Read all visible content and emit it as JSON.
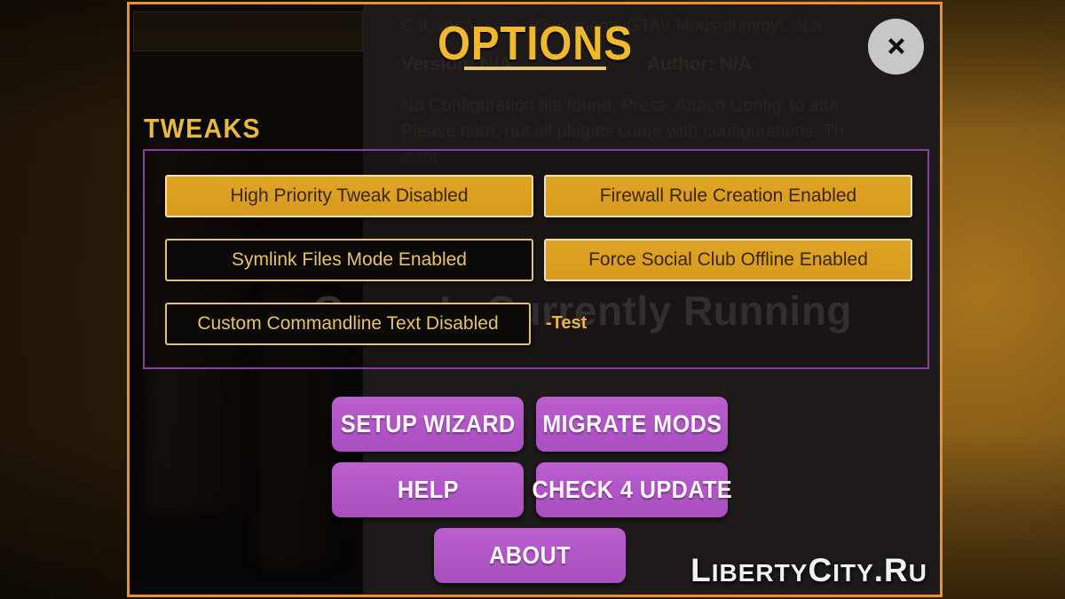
{
  "window": {
    "frame_color": "#ef8f2a",
    "background_color": "#110d0b"
  },
  "background": {
    "path": "C:\\Users\\______\\Documents\\GTAV Mods\\dummy\\...\\La",
    "version_label": "Version: N/A",
    "author_label": "Author: N/A",
    "description_line1": "No Configuration file found. Press 'Attach Config' to atta",
    "description_line2": "Please note, not all plugins come with configurations. Th",
    "description_line3": "error.",
    "status_text": "Game Is Currently Running"
  },
  "dialog": {
    "title": "OPTIONS",
    "title_color": "#f0b82b",
    "close_icon": "close-x-icon",
    "close_icon_bg": "#c7c7c7"
  },
  "tweaks": {
    "section_label": "TWEAKS",
    "panel_border_color": "#8a3fa0",
    "enabled_color": "#d79a1d",
    "disabled_color": "#0c0a09",
    "items": [
      {
        "id": "high-priority",
        "label": "High Priority Tweak Disabled",
        "state": "on"
      },
      {
        "id": "symlink",
        "label": "Symlink Files Mode Enabled",
        "state": "off"
      },
      {
        "id": "commandline",
        "label": "Custom Commandline Text Disabled",
        "state": "off"
      },
      {
        "id": "firewall",
        "label": "Firewall Rule Creation Enabled",
        "state": "on"
      },
      {
        "id": "social-club",
        "label": "Force Social Club Offline Enabled",
        "state": "on"
      }
    ],
    "commandline_value": "-Test"
  },
  "actions": {
    "accent_color": "#b055c6",
    "setup_wizard": "SETUP WIZARD",
    "migrate_mods": "MIGRATE MODS",
    "help": "HELP",
    "check_update": "CHECK 4 UPDATE",
    "about": "ABOUT"
  },
  "watermark": {
    "text_main": "L",
    "text_rest": "IBERTY",
    "text_c": "C",
    "text_ity": "ITY.R",
    "text_u": "U",
    "full": "LibertyCity.Ru"
  }
}
